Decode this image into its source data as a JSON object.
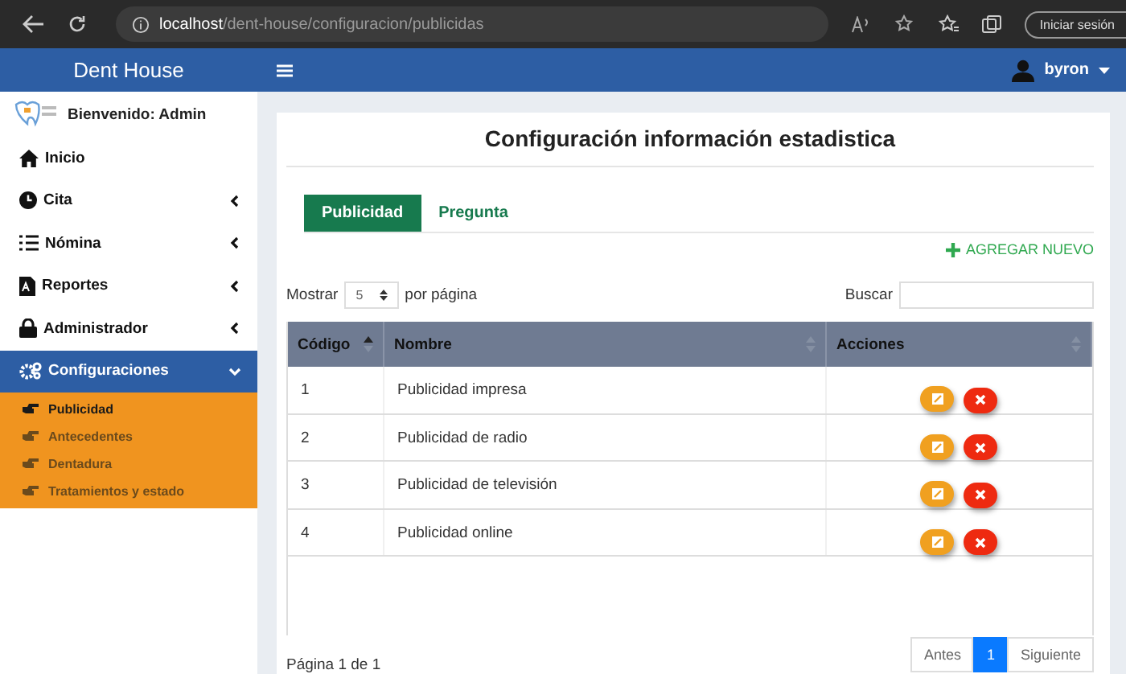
{
  "browser": {
    "url_host": "localhost",
    "url_path": "/dent-house/configuracion/publicidas",
    "signin": "Iniciar sesión"
  },
  "sidebar": {
    "brand": "Dent House",
    "welcome": "Bienvenido: Admin",
    "items": [
      {
        "label": "Inicio",
        "kind": "link",
        "selected": false
      },
      {
        "label": "Cita",
        "kind": "menu",
        "expanded": false,
        "selected": false
      },
      {
        "label": "Nómina",
        "kind": "menu",
        "expanded": false,
        "selected": false
      },
      {
        "label": "Reportes",
        "kind": "menu",
        "expanded": false,
        "selected": false
      },
      {
        "label": "Administrador",
        "kind": "menu",
        "expanded": false,
        "selected": false
      },
      {
        "label": "Configuraciones",
        "kind": "menu",
        "expanded": true,
        "selected": true,
        "children": [
          {
            "label": "Publicidad",
            "selected": true
          },
          {
            "label": "Antecedentes",
            "selected": false
          },
          {
            "label": "Dentadura",
            "selected": false
          },
          {
            "label": "Tratamientos y estado",
            "selected": false
          }
        ]
      }
    ]
  },
  "topbar": {
    "user": "byron"
  },
  "page": {
    "title": "Configuración información estadistica",
    "tabs": [
      {
        "label": "Publicidad",
        "selected": true
      },
      {
        "label": "Pregunta",
        "selected": false
      }
    ],
    "add_button": "AGREGAR NUEVO",
    "show_label": "Mostrar",
    "page_size": "5",
    "per_page_label": "por página",
    "search_label": "Buscar",
    "table": {
      "columns": [
        {
          "label": "Código",
          "sorted": true
        },
        {
          "label": "Nombre",
          "sorted": false
        },
        {
          "label": "Acciones",
          "sorted": false
        }
      ],
      "rows": [
        {
          "code": "1",
          "name": "Publicidad impresa"
        },
        {
          "code": "2",
          "name": "Publicidad de radio"
        },
        {
          "code": "3",
          "name": "Publicidad de televisión"
        },
        {
          "code": "4",
          "name": "Publicidad online"
        }
      ]
    },
    "page_info": "Página 1 de 1",
    "pagination": [
      {
        "label": "Antes",
        "selected": false
      },
      {
        "label": "1",
        "selected": true
      },
      {
        "label": "Siguiente",
        "selected": false
      }
    ]
  }
}
